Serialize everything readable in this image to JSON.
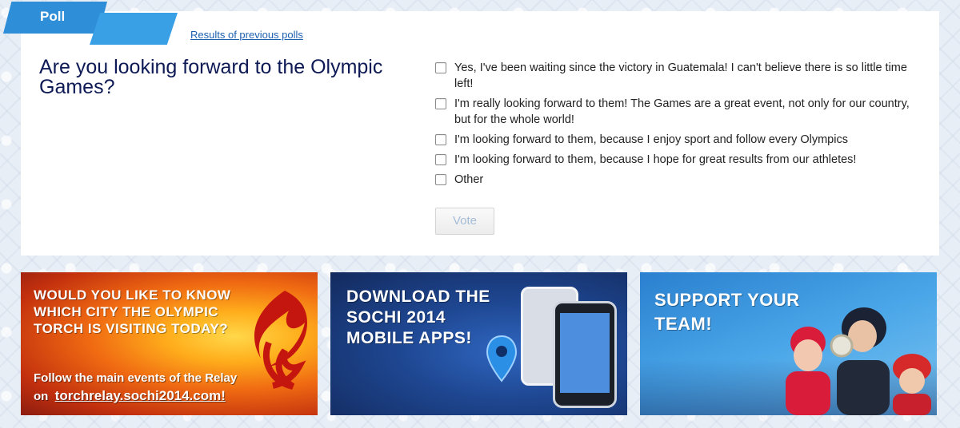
{
  "poll": {
    "tab_label": "Poll",
    "previous_link": "Results of previous polls",
    "question": "Are you looking forward to the Olympic Games?",
    "options": [
      "Yes, I've been waiting since the victory in Guatemala! I can't believe there is so little time left!",
      "I'm really looking forward to them! The Games are a great event, not only for our country, but for the whole world!",
      "I'm looking forward to them, because I enjoy sport and follow every Olympics",
      "I'm looking forward to them, because I hope for great results from our athletes!",
      "Other"
    ],
    "vote_label": "Vote"
  },
  "banners": {
    "torch": {
      "title": "Would you like to know which city the Olympic torch is visiting today?",
      "subtitle": "Follow the main events of the Relay",
      "prefix": "on",
      "url": "torchrelay.sochi2014.com!"
    },
    "apps": {
      "title": "Download the Sochi 2014 mobile apps!"
    },
    "team": {
      "title": "Support your team!"
    }
  },
  "colors": {
    "tab_blue": "#2e8fd8",
    "link_blue": "#1d5fb0",
    "question_navy": "#0e1a55"
  }
}
